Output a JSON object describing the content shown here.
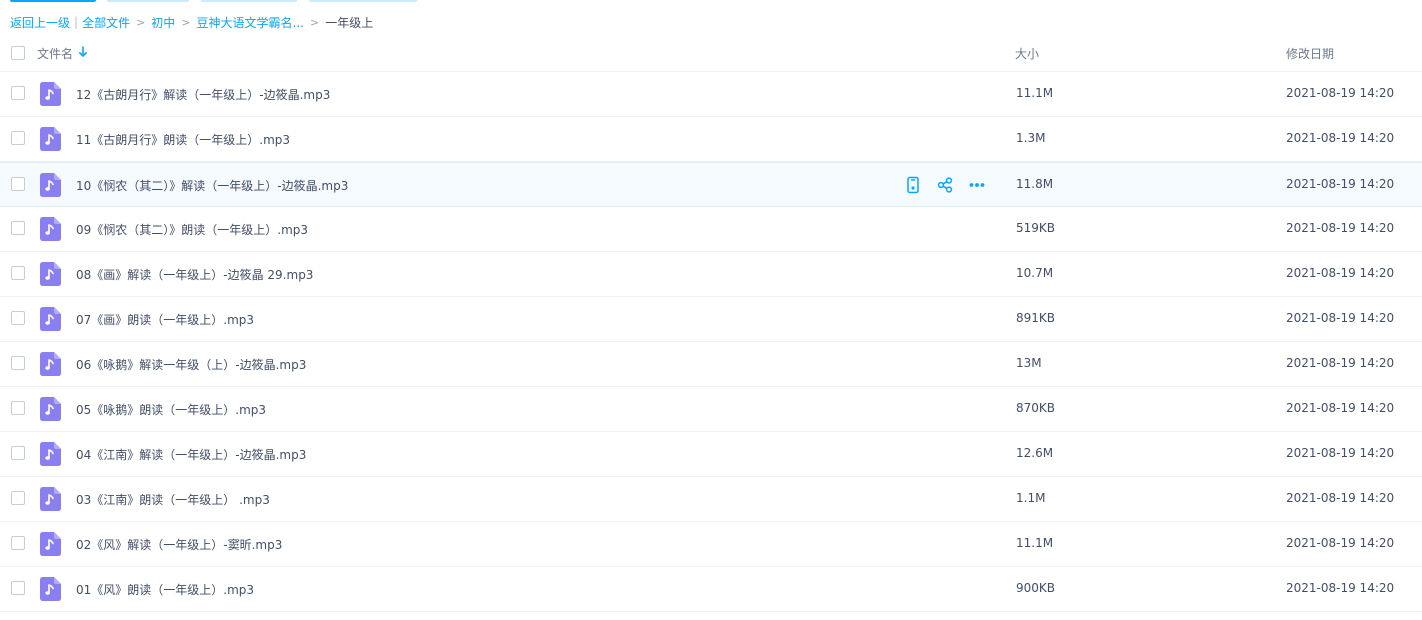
{
  "breadcrumb": {
    "back": "返回上一级",
    "pipe": "|",
    "items": [
      "全部文件",
      "初中",
      "豆神大语文学霸名..."
    ],
    "separator": ">",
    "current": "一年级上"
  },
  "table": {
    "columns": {
      "name": "文件名",
      "size": "大小",
      "date": "修改日期"
    },
    "sort_icon": "arrow-down-icon"
  },
  "colors": {
    "accent": "#06a7ff",
    "audio_icon": "#8a7ff0",
    "hover_row": "#f5faff"
  },
  "hover_actions": [
    "phone-icon",
    "share-icon",
    "more-icon"
  ],
  "files": [
    {
      "name": "12《古朗月行》解读（一年级上）-边筱晶.mp3",
      "size": "11.1M",
      "date": "2021-08-19 14:20"
    },
    {
      "name": "11《古朗月行》朗读（一年级上）.mp3",
      "size": "1.3M",
      "date": "2021-08-19 14:20"
    },
    {
      "name": "10《悯农（其二）》解读（一年级上）-边筱晶.mp3",
      "size": "11.8M",
      "date": "2021-08-19 14:20"
    },
    {
      "name": "09《悯农（其二）》朗读（一年级上）.mp3",
      "size": "519KB",
      "date": "2021-08-19 14:20"
    },
    {
      "name": "08《画》解读（一年级上）-边筱晶 29.mp3",
      "size": "10.7M",
      "date": "2021-08-19 14:20"
    },
    {
      "name": "07《画》朗读（一年级上）.mp3",
      "size": "891KB",
      "date": "2021-08-19 14:20"
    },
    {
      "name": "06《咏鹅》解读一年级（上）-边筱晶.mp3",
      "size": "13M",
      "date": "2021-08-19 14:20"
    },
    {
      "name": "05《咏鹅》朗读（一年级上）.mp3",
      "size": "870KB",
      "date": "2021-08-19 14:20"
    },
    {
      "name": "04《江南》解读（一年级上）-边筱晶.mp3",
      "size": "12.6M",
      "date": "2021-08-19 14:20"
    },
    {
      "name": "03《江南》朗读（一年级上） .mp3",
      "size": "1.1M",
      "date": "2021-08-19 14:20"
    },
    {
      "name": "02《风》解读（一年级上）-窦昕.mp3",
      "size": "11.1M",
      "date": "2021-08-19 14:20"
    },
    {
      "name": "01《风》朗读（一年级上）.mp3",
      "size": "900KB",
      "date": "2021-08-19 14:20"
    }
  ]
}
